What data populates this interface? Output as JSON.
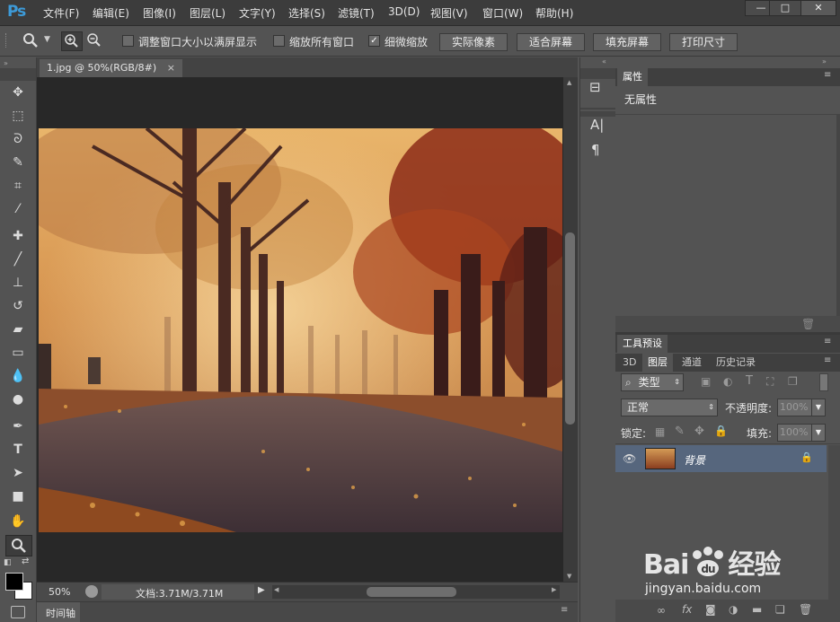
{
  "app": {
    "logo": "Ps"
  },
  "menu": [
    "文件(F)",
    "编辑(E)",
    "图像(I)",
    "图层(L)",
    "文字(Y)",
    "选择(S)",
    "滤镜(T)",
    "3D(D)",
    "视图(V)",
    "窗口(W)",
    "帮助(H)"
  ],
  "window_controls": {
    "minimize": "—",
    "maximize": "□",
    "close": "✕"
  },
  "options": {
    "resize_windows_label": "调整窗口大小以满屏显示",
    "zoom_all_windows_label": "缩放所有窗口",
    "scrubby_zoom_label": "细微缩放",
    "scrubby_zoom_checked": "✓",
    "actual_pixels": "实际像素",
    "fit_screen": "适合屏幕",
    "fill_screen": "填充屏幕",
    "print_size": "打印尺寸"
  },
  "document": {
    "tab_title": "1.jpg @ 50%(RGB/8#)",
    "tab_close": "×",
    "zoom": "50%",
    "doc_info": "文档:3.71M/3.71M"
  },
  "timeline_label": "时间轴",
  "properties_panel": {
    "title": "属性",
    "content": "无属性"
  },
  "tool_presets_tab": "工具预设",
  "layers_panel": {
    "tabs": [
      "3D",
      "图层",
      "通道",
      "历史记录"
    ],
    "active_tab": "图层",
    "filter_kind": "类型",
    "blend_mode": "正常",
    "opacity_label": "不透明度:",
    "opacity_value": "100%",
    "lock_label": "锁定:",
    "fill_label": "填充:",
    "fill_value": "100%",
    "layer_name": "背景"
  },
  "watermark": {
    "brand": "Bai",
    "brand2": "du",
    "product": "经验",
    "url": "jingyan.baidu.com"
  },
  "colors": {
    "accent": "#3d9bd9",
    "selected_layer": "#56667d",
    "canvas": "#282828"
  }
}
